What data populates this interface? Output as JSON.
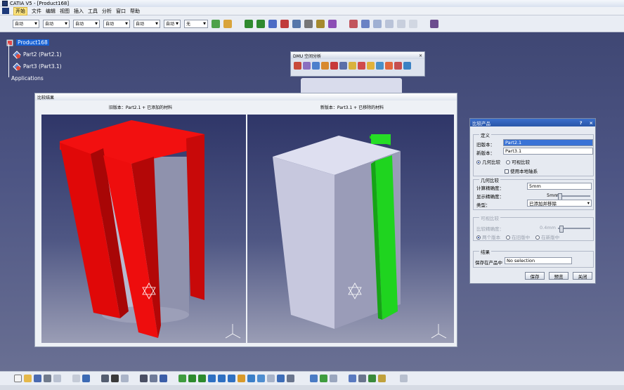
{
  "window": {
    "title": "CATIA V5 - [Product168]"
  },
  "menu": [
    "开始",
    "文件",
    "编辑",
    "视图",
    "插入",
    "工具",
    "分析",
    "窗口",
    "帮助"
  ],
  "toolbar": {
    "combos": [
      "自动",
      "自动",
      "自动",
      "自动",
      "自动",
      "自动",
      "无"
    ]
  },
  "tree": {
    "root": "Product168",
    "items": [
      "Part2 (Part2.1)",
      "Part3 (Part3.1)",
      "Applications"
    ]
  },
  "dmu_toolbar": {
    "title": "DMU 空间分析"
  },
  "compare_window": {
    "title": "比较结果",
    "left_caption": "旧版本：Part2.1 + 已添加的材料",
    "right_caption": "新版本：Part3.1 + 已移除的材料"
  },
  "compare_panel": {
    "title": "比较产品",
    "help_button": "?",
    "close_button": "×",
    "definition": {
      "title": "定义",
      "old_label": "旧版本：",
      "old_value": "Part2.1",
      "new_label": "新版本：",
      "new_value": "Part3.1",
      "geometric_option": "几何比较",
      "visual_option": "可视比较",
      "local_axis_label": "使用本地轴系"
    },
    "geometric": {
      "title": "几何比较",
      "calc_label": "计算精确度：",
      "calc_value": "5mm",
      "display_label": "显示精确度：",
      "display_value": "5mm",
      "type_label": "类型：",
      "type_value": "已添加并移除"
    },
    "visual": {
      "title": "可视比较",
      "precision_label": "比较精确度：",
      "precision_value": "0.4mm",
      "options": [
        "两个版本",
        "在旧版中",
        "在新版中"
      ]
    },
    "result": {
      "title": "结果",
      "save_label": "保存在产品中",
      "save_value": "No selection"
    },
    "buttons": {
      "save": "保存",
      "preview": "预览",
      "close": "关闭"
    }
  },
  "colors": {
    "added_material": "#e80a0a",
    "removed_material": "#1fd41f",
    "part_body": "#c9cbe2"
  }
}
